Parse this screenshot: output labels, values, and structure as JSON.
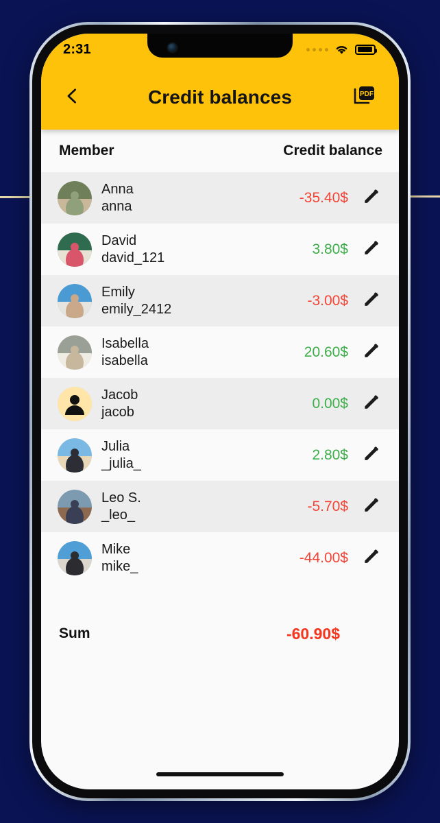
{
  "background": {
    "color": "#0a1455",
    "accent_line_color": "#f3e2b0"
  },
  "theme": {
    "header_yellow": "#ffc20a",
    "negative": "#f44336",
    "positive": "#3dae49",
    "sum_negative": "#f4361f",
    "row_alt": "#ededed",
    "row_base": "#fafafa"
  },
  "statusbar": {
    "time": "2:31",
    "signal_icon": "signal-dots-icon",
    "wifi_icon": "wifi-icon",
    "battery_icon": "battery-icon"
  },
  "navbar": {
    "back_icon": "chevron-left-icon",
    "title": "Credit balances",
    "pdf_icon": "pdf-export-icon"
  },
  "table": {
    "columns": [
      "Member",
      "Credit balance"
    ],
    "rows": [
      {
        "name": "Anna",
        "username": "anna",
        "amount": "-35.40$",
        "sign": "neg",
        "avatar": "photo",
        "edit_icon": "pencil-icon"
      },
      {
        "name": "David",
        "username": "david_121",
        "amount": "3.80$",
        "sign": "pos",
        "avatar": "photo",
        "edit_icon": "pencil-icon"
      },
      {
        "name": "Emily",
        "username": "emily_2412",
        "amount": "-3.00$",
        "sign": "neg",
        "avatar": "photo",
        "edit_icon": "pencil-icon"
      },
      {
        "name": "Isabella",
        "username": "isabella",
        "amount": "20.60$",
        "sign": "pos",
        "avatar": "photo",
        "edit_icon": "pencil-icon"
      },
      {
        "name": "Jacob",
        "username": "jacob",
        "amount": "0.00$",
        "sign": "pos",
        "avatar": "placeholder",
        "edit_icon": "pencil-icon"
      },
      {
        "name": "Julia",
        "username": "_julia_",
        "amount": "2.80$",
        "sign": "pos",
        "avatar": "photo",
        "edit_icon": "pencil-icon"
      },
      {
        "name": "Leo S.",
        "username": "_leo_",
        "amount": "-5.70$",
        "sign": "neg",
        "avatar": "photo",
        "edit_icon": "pencil-icon"
      },
      {
        "name": "Mike",
        "username": "mike_",
        "amount": "-44.00$",
        "sign": "neg",
        "avatar": "photo",
        "edit_icon": "pencil-icon"
      }
    ]
  },
  "summary": {
    "label": "Sum",
    "value": "-60.90$"
  }
}
